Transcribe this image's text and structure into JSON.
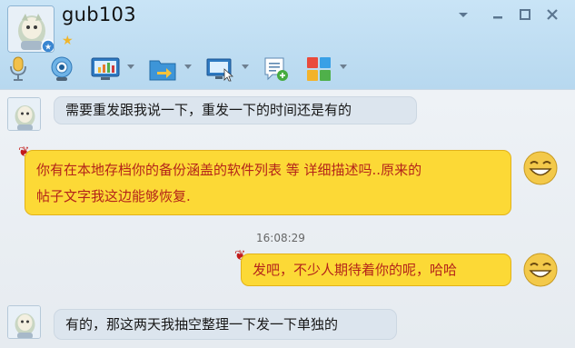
{
  "header": {
    "title": "gub103",
    "star": "★",
    "controls": {
      "dropdown_icon": "chevron-down-icon",
      "minimize_icon": "minimize-icon",
      "maximize_icon": "maximize-icon",
      "close_icon": "close-icon"
    }
  },
  "toolbar": {
    "items": [
      {
        "icon": "microphone-icon",
        "has_dropdown": false
      },
      {
        "icon": "webcam-icon",
        "has_dropdown": false
      },
      {
        "icon": "screen-share-icon",
        "has_dropdown": true
      },
      {
        "icon": "folder-transfer-icon",
        "has_dropdown": true
      },
      {
        "icon": "remote-desktop-icon",
        "has_dropdown": true
      },
      {
        "icon": "add-note-icon",
        "has_dropdown": false
      },
      {
        "icon": "apps-grid-icon",
        "has_dropdown": true
      }
    ]
  },
  "chat": {
    "messages": [
      {
        "sender": "contact",
        "text": "需要重发跟我说一下，重发一下的时间还是有的"
      },
      {
        "sender": "self",
        "lines": [
          "你有在本地存档你的备份涵盖的软件列表 等 详细描述吗..原来的",
          "帖子文字我这边能够恢复."
        ]
      },
      {
        "sender": "timestamp",
        "text": "16:08:29"
      },
      {
        "sender": "self",
        "text": "发吧，不少人期待着你的呢，哈哈"
      },
      {
        "sender": "contact",
        "text": "有的，那这两天我抽空整理一下发一下单独的"
      }
    ]
  },
  "colors": {
    "header_bg": "#c3e1f5",
    "chat_bg": "#eaeff4",
    "contact_bubble": "#dce5ee",
    "self_bubble": "#fcd936",
    "self_text": "#b4241a"
  }
}
